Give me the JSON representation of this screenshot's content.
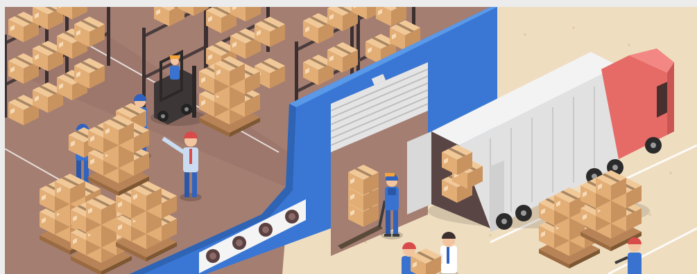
{
  "image": {
    "subject": "isometric-warehouse-logistics",
    "icons": [
      "forklift-icon",
      "truck-icon",
      "box-icon",
      "worker-icon",
      "pallet-jack-icon",
      "roller-door-icon"
    ]
  },
  "colors": {
    "warehouse_floor": "#a57e72",
    "outside_ground": "#efddc0",
    "wall_blue": "#3a77d4",
    "wall_blue_light": "#4b8ae0",
    "box": "#e7b987",
    "box_dark": "#c99360",
    "tape": "#8a6a4c",
    "shelf": "#4a3c3c",
    "truck_cab": "#e66b67",
    "truck_body": "#e9eaea",
    "worker_uniform": "#2f63bf",
    "helmet": "#f2a43a",
    "cap_red": "#d84b4b"
  }
}
